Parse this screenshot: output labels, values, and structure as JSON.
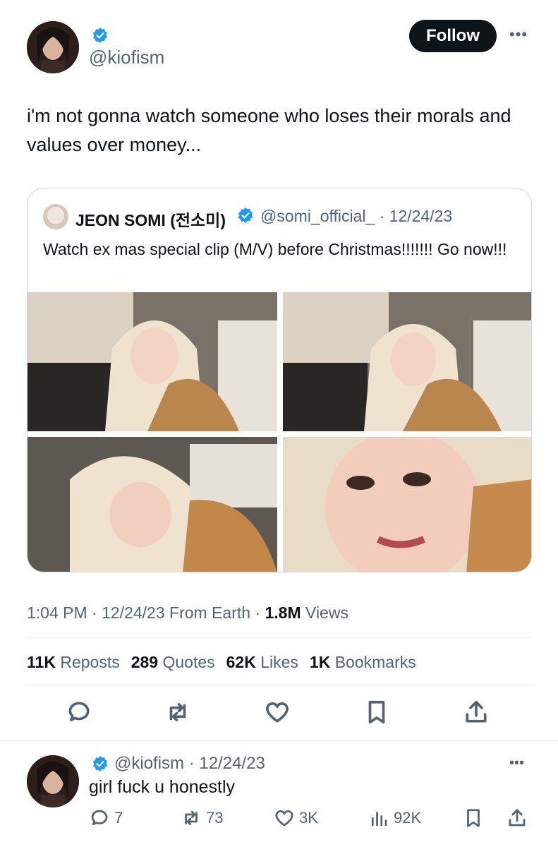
{
  "tweet": {
    "handle": "@kiofism",
    "follow_label": "Follow",
    "more_label": "•••",
    "text": "i'm not gonna watch someone who loses their morals and values over money...",
    "timestamp": "1:04 PM · 12/24/23 From Earth · ",
    "views_count": "1.8M",
    "views_label": " Views",
    "verified_color": "#1d9bf0",
    "stats": {
      "reposts_count": "11K",
      "reposts_label": "Reposts",
      "quotes_count": "289",
      "quotes_label": "Quotes",
      "likes_count": "62K",
      "likes_label": "Likes",
      "bookmarks_count": "1K",
      "bookmarks_label": "Bookmarks"
    },
    "actions": [
      "reply-icon",
      "repost-icon",
      "like-icon",
      "bookmark-icon",
      "share-icon"
    ]
  },
  "quote": {
    "name": "JEON SOMI (전소미)",
    "handle_date": "@somi_official_ · 12/24/23",
    "text": "Watch ex mas special clip (M/V) before Christmas!!!!!!! Go now!!!"
  },
  "reply": {
    "handle_date": "@kiofism · 12/24/23",
    "more_label": "•••",
    "text": "girl fuck u honestly",
    "reply_count": "7",
    "repost_count": "73",
    "like_count": "3K",
    "views_count": "92K"
  }
}
